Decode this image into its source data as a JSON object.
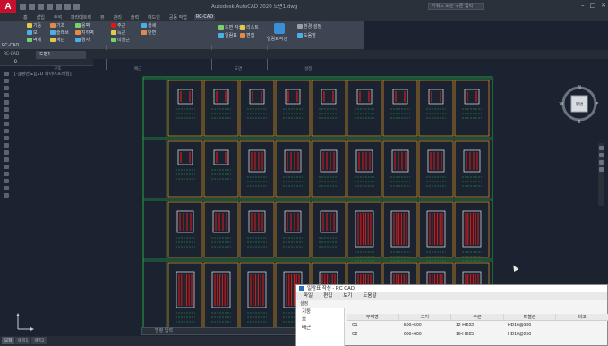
{
  "titlebar": {
    "app_logo": "A",
    "window_title": "Autodesk AutoCAD 2020  도면1.dwg",
    "search_placeholder": "키워드 또는 구문 입력",
    "controls": [
      "–",
      "□",
      "✕"
    ]
  },
  "ribbon": {
    "tabs": [
      "홈",
      "삽입",
      "주석",
      "파라메트릭",
      "뷰",
      "관리",
      "출력",
      "애드인",
      "공동 작업",
      "RC-CAD"
    ],
    "active_tab": "RC-CAD",
    "panel_label": "RC-CAD",
    "groups": [
      {
        "title": "구조",
        "buttons": [
          "기둥",
          "보",
          "벽체",
          "기초",
          "슬래브",
          "계단",
          "옹벽",
          "지하벽",
          "경사"
        ]
      },
      {
        "title": "배근",
        "buttons": [
          "주근",
          "늑근",
          "띠철근",
          "상세",
          "단면"
        ]
      },
      {
        "title": "도면",
        "buttons": [
          "도면 작성",
          "일람표",
          "리스트",
          "편집"
        ]
      },
      {
        "title": "설정",
        "buttons": [
          "환경 설정",
          "도움말"
        ]
      }
    ],
    "big_button": "일람표작성"
  },
  "doc_tabs": {
    "left_label": "RC-CAD",
    "active": "도면1"
  },
  "layer": {
    "name": "0"
  },
  "view_label": "[-][평면도][2D 와이어프레임]",
  "viewcube": {
    "face": "평면",
    "north": "N",
    "south": "S",
    "east": "E",
    "west": "W"
  },
  "command": {
    "placeholder": "명령 입력"
  },
  "status": {
    "tabs": [
      "모형",
      "배치1",
      "배치2"
    ],
    "active": "모형"
  },
  "dialog": {
    "title": "일람표 작성 - RC CAD",
    "menus": [
      "파일",
      "편집",
      "보기",
      "도움말"
    ],
    "toolbar": "설정",
    "tree": [
      "기둥",
      "보",
      "배근"
    ],
    "headers": [
      "부재명",
      "크기",
      "주근",
      "띠철근",
      "비고"
    ],
    "rows": [
      [
        "C1",
        "500×500",
        "12-HD22",
        "HD10@300"
      ],
      [
        "C2",
        "600×600",
        "16-HD25",
        "HD10@250"
      ]
    ]
  },
  "colors": {
    "canvas": "#1b2330",
    "frame_orange": "#e39a20",
    "frame_green": "#27b24a",
    "rebar_red": "#e01818",
    "section_white": "#e8e8e8"
  }
}
